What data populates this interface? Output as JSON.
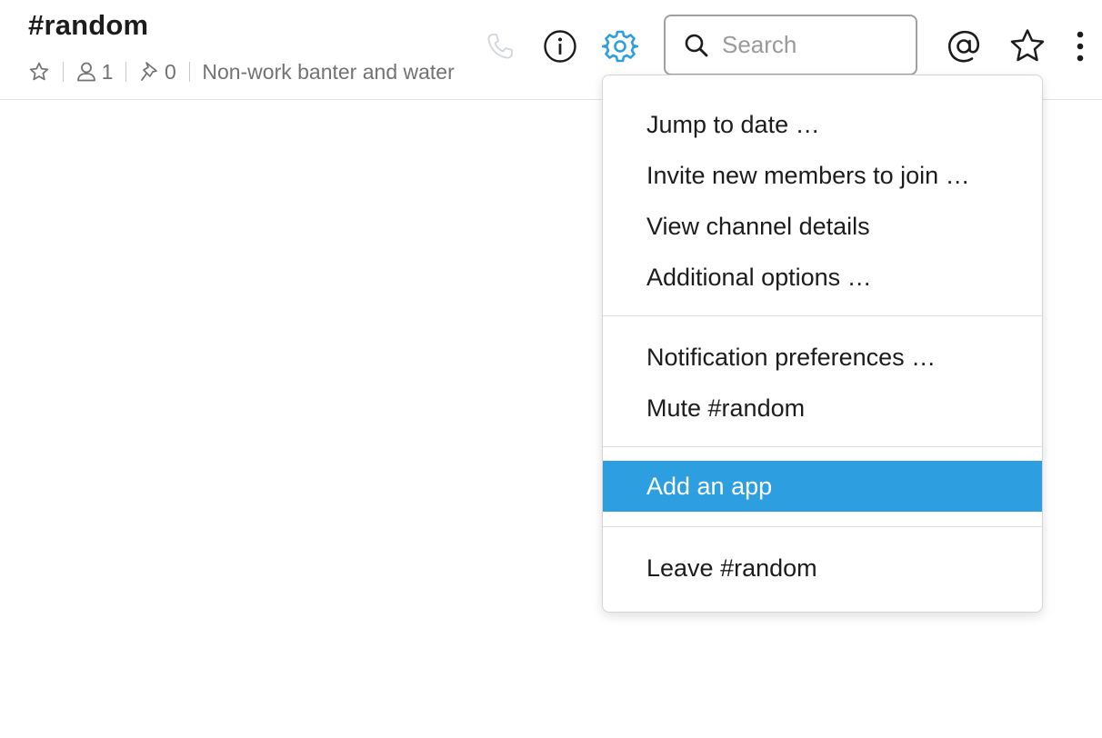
{
  "header": {
    "channel_name": "#random",
    "member_count": "1",
    "pinned_count": "0",
    "topic": "Non-work banter and water cooler conversation"
  },
  "toolbar": {
    "icons": [
      "phone-icon",
      "info-icon",
      "gear-icon",
      "at-mention-icon",
      "star-icon",
      "more-vertical-icon"
    ],
    "search_placeholder": "Search"
  },
  "menu": {
    "group1": [
      "Jump to date …",
      "Invite new members to join …",
      "View channel details",
      "Additional options …"
    ],
    "group2": [
      "Notification preferences …",
      "Mute #random"
    ],
    "group3": [
      "Add an app"
    ],
    "group4": [
      "Leave #random"
    ]
  },
  "colors": {
    "highlight": "#2d9ee0",
    "gear_active": "#2d9ee0",
    "muted_text": "#717274"
  }
}
